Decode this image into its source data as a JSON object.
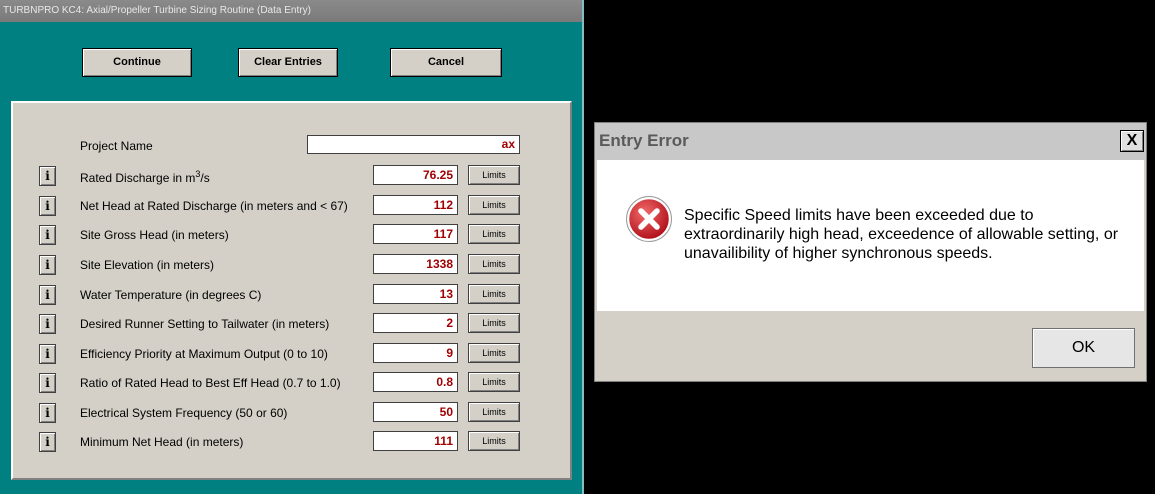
{
  "left_window": {
    "title": "TURBNPRO KC4: Axial/Propeller Turbine Sizing Routine (Data Entry)",
    "buttons": {
      "continue": "Continue",
      "clear": "Clear Entries",
      "cancel": "Cancel"
    },
    "project": {
      "label": "Project Name",
      "value": "ax"
    },
    "info_label": "i",
    "limits_label": "Limits",
    "fields": [
      {
        "label_before": "Rated Discharge in m",
        "superscript": "3",
        "label_after": "/s",
        "value": "76.25"
      },
      {
        "label": "Net Head at Rated Discharge (in meters and < 67)",
        "value": "112"
      },
      {
        "label": "Site Gross Head (in meters)",
        "value": "117"
      },
      {
        "label": "Site Elevation (in meters)",
        "value": "1338"
      },
      {
        "label": "Water Temperature (in degrees C)",
        "value": "13"
      },
      {
        "label": "Desired Runner Setting to Tailwater (in meters)",
        "value": "2"
      },
      {
        "label": "Efficiency Priority at Maximum Output (0 to 10)",
        "value": "9"
      },
      {
        "label": "Ratio of Rated Head to Best Eff Head (0.7 to 1.0)",
        "value": "0.8"
      },
      {
        "label": "Electrical System Frequency (50 or 60)",
        "value": "50"
      },
      {
        "label": "Minimum Net Head (in meters)",
        "value": "111"
      }
    ]
  },
  "dialog": {
    "title": "Entry Error",
    "close_label": "X",
    "icon": "error-icon",
    "message": "Specific Speed limits have been exceeded due to extraordinarily high head, exceedence of allowable setting, or unavailibility of higher synchronous speeds.",
    "ok_label": "OK"
  },
  "colors": {
    "window_background": "#008080",
    "panel_background": "#d4d0c8",
    "value_text": "#a00000",
    "error_icon": "#c8141e"
  }
}
